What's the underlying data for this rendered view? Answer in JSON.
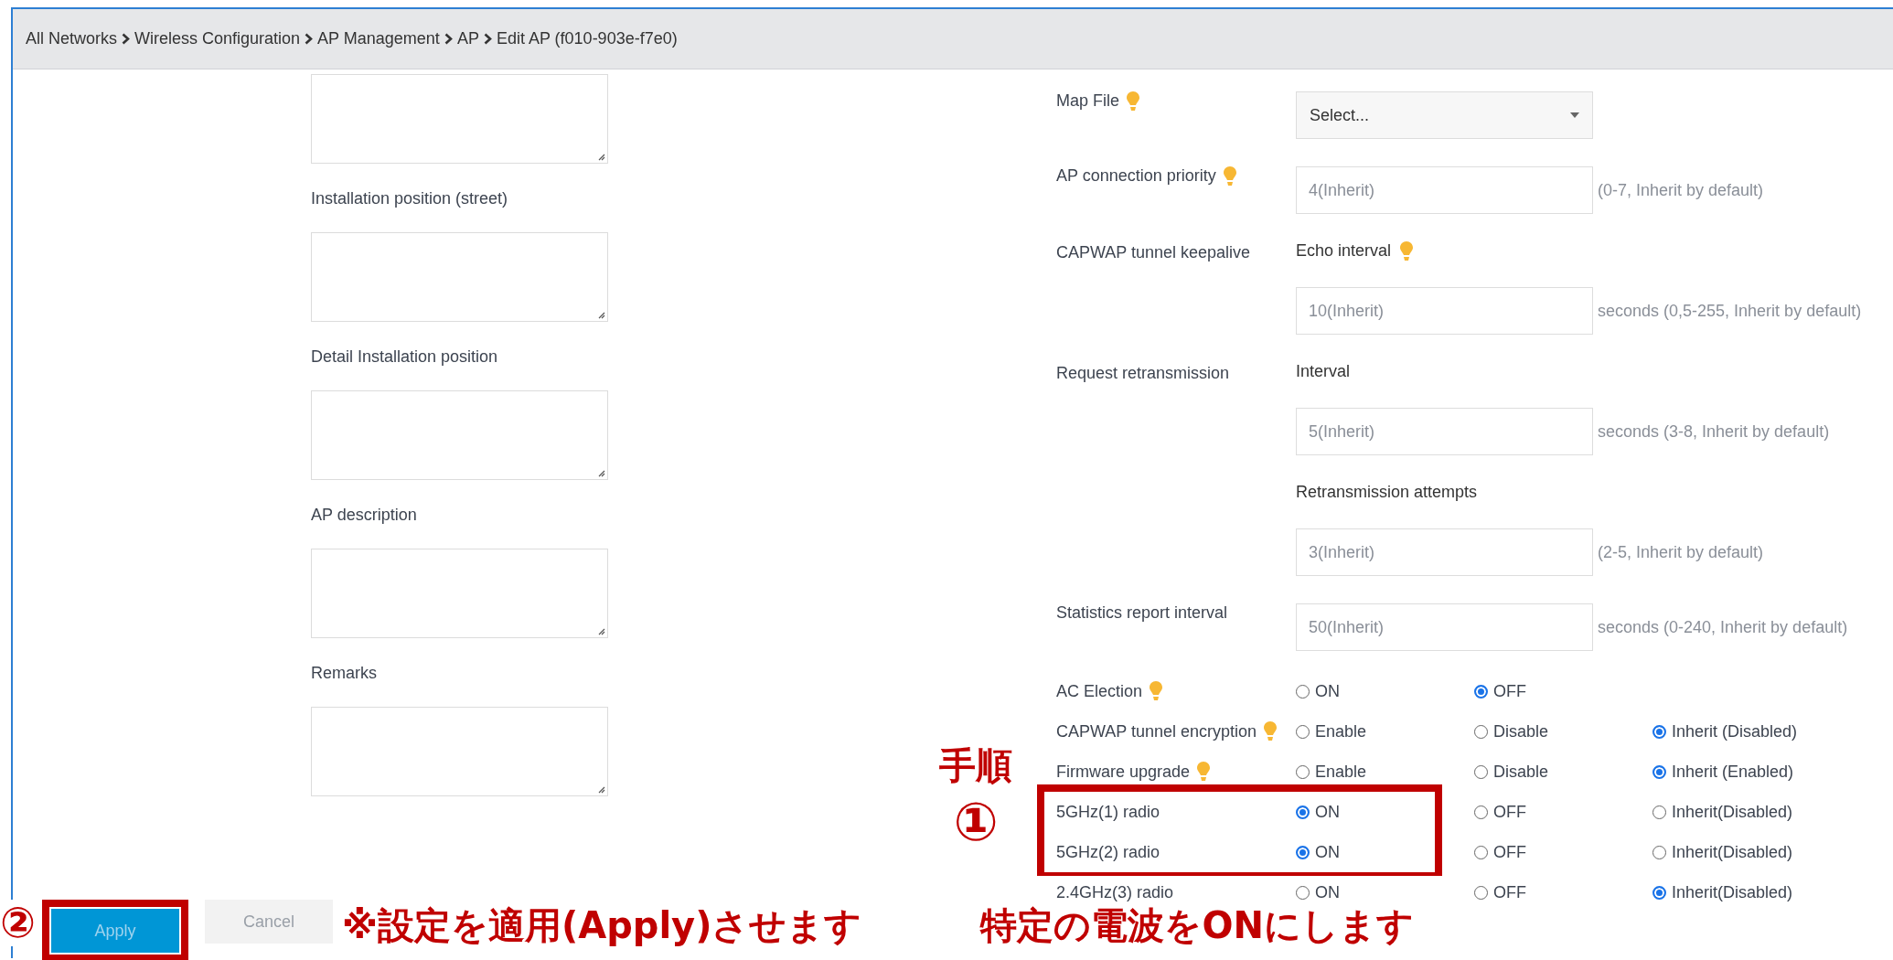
{
  "breadcrumb": [
    "All Networks",
    "Wireless Configuration",
    "AP Management",
    "AP",
    "Edit AP (f010-903e-f7e0)"
  ],
  "left_fields": [
    {
      "kind": "textarea"
    },
    {
      "kind": "textarea",
      "label": "Installation position (street)"
    },
    {
      "kind": "textarea",
      "label": "Detail Installation position"
    },
    {
      "kind": "textarea",
      "label": "AP description"
    },
    {
      "kind": "textarea",
      "label": "Remarks"
    }
  ],
  "right_rows": [
    {
      "kind": "select",
      "label": "Map File",
      "hint_icon": true,
      "value": "Select..."
    },
    {
      "kind": "input",
      "label": "AP connection priority",
      "hint_icon": true,
      "placeholder": "4(Inherit)",
      "note": "(0-7, Inherit by default)"
    },
    {
      "kind": "subheading",
      "label": "CAPWAP tunnel keepalive",
      "sublabel": "Echo interval",
      "hint_icon": true
    },
    {
      "kind": "input",
      "placeholder": "10(Inherit)",
      "note": "seconds (0,5-255, Inherit by default)"
    },
    {
      "kind": "subheading",
      "label": "Request retransmission",
      "sublabel": "Interval"
    },
    {
      "kind": "input",
      "placeholder": "5(Inherit)",
      "note": "seconds (3-8, Inherit by default)"
    },
    {
      "kind": "subheading",
      "sublabel": "Retransmission attempts"
    },
    {
      "kind": "input",
      "placeholder": "3(Inherit)",
      "note": "(2-5, Inherit by default)"
    },
    {
      "kind": "input",
      "label": "Statistics report interval",
      "placeholder": "50(Inherit)",
      "note": "seconds (0-240, Inherit by default)"
    }
  ],
  "radio_rows": [
    {
      "kind": "row",
      "label": "AC Election",
      "hint_icon": true,
      "options": [
        {
          "label": "ON",
          "selected": false
        },
        {
          "label": "OFF",
          "selected": true
        }
      ]
    },
    {
      "kind": "row",
      "label": "CAPWAP tunnel encryption",
      "hint_icon": true,
      "options": [
        {
          "label": "Enable",
          "selected": false
        },
        {
          "label": "Disable",
          "selected": false
        },
        {
          "label": "Inherit (Disabled)",
          "selected": true
        }
      ]
    },
    {
      "kind": "row",
      "label": "Firmware upgrade",
      "hint_icon": true,
      "options": [
        {
          "label": "Enable",
          "selected": false
        },
        {
          "label": "Disable",
          "selected": false
        },
        {
          "label": "Inherit (Enabled)",
          "selected": true
        }
      ]
    },
    {
      "kind": "highlight_group",
      "rows": [
        {
          "label": "5GHz(1) radio",
          "options": [
            {
              "label": "ON",
              "selected": true
            },
            {
              "label": "OFF",
              "selected": false
            },
            {
              "label": "Inherit(Disabled)",
              "selected": false
            }
          ]
        },
        {
          "label": "5GHz(2) radio",
          "options": [
            {
              "label": "ON",
              "selected": true
            },
            {
              "label": "OFF",
              "selected": false
            },
            {
              "label": "Inherit(Disabled)",
              "selected": false
            }
          ]
        }
      ]
    },
    {
      "kind": "row",
      "label": "2.4GHz(3) radio",
      "options": [
        {
          "label": "ON",
          "selected": false
        },
        {
          "label": "OFF",
          "selected": false
        },
        {
          "label": "Inherit(Disabled)",
          "selected": true
        }
      ]
    }
  ],
  "buttons": [
    {
      "label": "Apply",
      "kind": "primary",
      "highlighted": true
    },
    {
      "label": "Cancel",
      "kind": "secondary",
      "highlighted": false
    }
  ],
  "annotations": {
    "step1": {
      "heading": "手順",
      "number": "①",
      "caption": "特定の電波をONにします"
    },
    "step2": {
      "number": "②",
      "caption": "※設定を適用(Apply)させます"
    }
  }
}
